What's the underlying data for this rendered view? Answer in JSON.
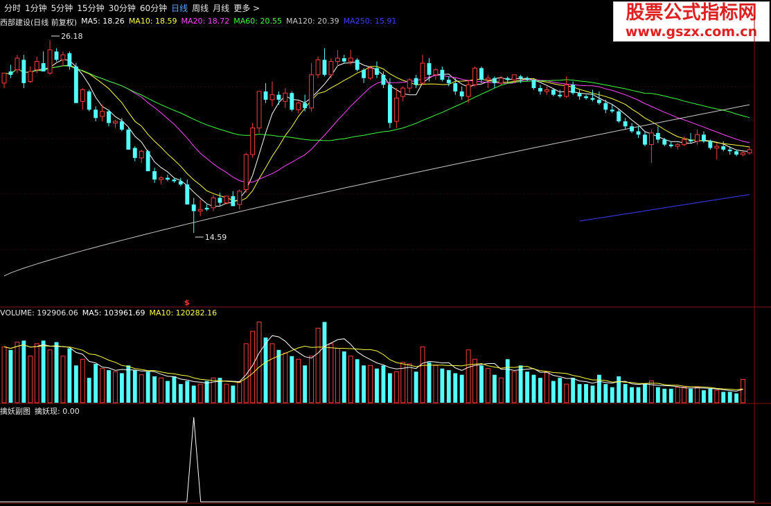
{
  "toolbar": {
    "items": [
      {
        "label": "分时",
        "active": false
      },
      {
        "label": "1分钟",
        "active": false
      },
      {
        "label": "5分钟",
        "active": false
      },
      {
        "label": "15分钟",
        "active": false
      },
      {
        "label": "30分钟",
        "active": false
      },
      {
        "label": "60分钟",
        "active": false
      },
      {
        "label": "日线",
        "active": true
      },
      {
        "label": "周线",
        "active": false
      },
      {
        "label": "月线",
        "active": false
      },
      {
        "label": "更多 >",
        "active": false
      }
    ]
  },
  "watermark": {
    "title": "股票公式指标网",
    "url": "www.gszx.com.cn"
  },
  "price_legend": {
    "name": "西部建设(日线 前复权)",
    "ma5": "MA5: 18.26",
    "ma10": "MA10: 18.59",
    "ma20": "MA20: 18.72",
    "ma60": "MA60: 20.55",
    "ma120": "MA120: 20.39",
    "ma250": "MA250: 15.91"
  },
  "volume_legend": {
    "volume": "VOLUME: 192906.06",
    "ma5": "MA5: 103961.69",
    "ma10": "MA10: 120282.16"
  },
  "indicator_legend": {
    "name": "擒妖副图",
    "value": "擒妖现: 0.00"
  },
  "marker": "$",
  "colors": {
    "up": "#ff3c3c",
    "down": "#54ffff",
    "ma5": "#ffffff",
    "ma10": "#ffff3c",
    "ma20": "#ff46ff",
    "ma60": "#3cff3c",
    "ma120": "#c8c8c8",
    "ma250": "#3c3cff"
  },
  "chart_data": [
    {
      "type": "candlestick",
      "title": "西部建设(日线 前复权)",
      "y_range": [
        14.0,
        27.0
      ],
      "annotations": [
        {
          "label": "26.18",
          "value": 26.18,
          "kind": "high"
        },
        {
          "label": "14.59",
          "value": 14.59,
          "kind": "low"
        }
      ],
      "candles": [
        [
          23.6,
          24.2,
          23.3,
          24.2
        ],
        [
          24.3,
          24.7,
          23.9,
          24.1
        ],
        [
          24.4,
          25.3,
          24.2,
          25.1
        ],
        [
          25.0,
          25.3,
          23.3,
          23.6
        ],
        [
          23.7,
          24.6,
          23.6,
          24.3
        ],
        [
          24.4,
          25.2,
          24.2,
          24.9
        ],
        [
          24.8,
          25.5,
          24.3,
          24.3
        ],
        [
          24.2,
          26.18,
          24.1,
          25.6
        ],
        [
          25.5,
          25.7,
          24.9,
          25.0
        ],
        [
          25.0,
          25.5,
          24.6,
          25.3
        ],
        [
          25.4,
          25.5,
          24.4,
          24.6
        ],
        [
          24.6,
          24.8,
          22.4,
          22.4
        ],
        [
          22.5,
          23.3,
          22.0,
          23.2
        ],
        [
          23.1,
          23.2,
          21.9,
          22.0
        ],
        [
          22.0,
          22.2,
          21.3,
          21.5
        ],
        [
          21.6,
          22.3,
          21.3,
          21.9
        ],
        [
          21.9,
          22.0,
          21.0,
          21.2
        ],
        [
          21.2,
          21.4,
          20.9,
          21.3
        ],
        [
          21.3,
          21.5,
          20.7,
          20.8
        ],
        [
          20.8,
          20.9,
          19.6,
          19.6
        ],
        [
          19.7,
          19.8,
          18.9,
          19.1
        ],
        [
          19.1,
          19.6,
          18.8,
          19.5
        ],
        [
          19.5,
          19.6,
          18.3,
          18.3
        ],
        [
          18.3,
          18.5,
          17.6,
          17.8
        ],
        [
          17.8,
          18.0,
          17.5,
          17.9
        ],
        [
          17.9,
          18.1,
          17.7,
          17.8
        ],
        [
          17.8,
          17.9,
          17.6,
          17.7
        ],
        [
          17.7,
          17.9,
          17.4,
          17.5
        ],
        [
          17.5,
          17.8,
          16.3,
          16.3
        ],
        [
          16.3,
          16.7,
          14.59,
          15.9
        ],
        [
          15.9,
          16.6,
          15.6,
          16.0
        ],
        [
          16.1,
          16.3,
          15.9,
          16.0
        ],
        [
          16.1,
          16.9,
          15.9,
          16.7
        ],
        [
          16.7,
          17.0,
          16.2,
          16.4
        ],
        [
          16.4,
          16.8,
          16.3,
          16.8
        ],
        [
          16.8,
          17.1,
          16.2,
          16.2
        ],
        [
          16.3,
          17.2,
          16.0,
          17.1
        ],
        [
          17.2,
          19.4,
          17.0,
          19.3
        ],
        [
          19.3,
          21.2,
          19.1,
          20.9
        ],
        [
          20.9,
          23.1,
          20.6,
          23.1
        ],
        [
          23.1,
          23.6,
          22.4,
          22.6
        ],
        [
          22.6,
          23.7,
          22.2,
          22.9
        ],
        [
          22.9,
          23.1,
          22.3,
          22.6
        ],
        [
          22.5,
          23.3,
          22.1,
          23.0
        ],
        [
          23.0,
          23.1,
          21.9,
          22.0
        ],
        [
          22.0,
          22.5,
          21.8,
          22.4
        ],
        [
          22.4,
          22.9,
          21.9,
          22.1
        ],
        [
          22.1,
          24.8,
          21.9,
          24.1
        ],
        [
          24.1,
          25.2,
          23.9,
          25.0
        ],
        [
          25.0,
          25.7,
          24.0,
          24.1
        ],
        [
          24.1,
          25.1,
          23.9,
          24.9
        ],
        [
          24.9,
          25.6,
          24.6,
          25.1
        ],
        [
          25.1,
          25.3,
          24.8,
          24.9
        ],
        [
          24.9,
          25.6,
          24.7,
          25.1
        ],
        [
          25.0,
          25.1,
          24.3,
          24.4
        ],
        [
          24.4,
          24.5,
          23.6,
          23.9
        ],
        [
          23.9,
          24.6,
          23.8,
          24.5
        ],
        [
          24.5,
          24.9,
          23.9,
          24.1
        ],
        [
          24.1,
          24.3,
          23.3,
          23.5
        ],
        [
          23.5,
          23.9,
          20.9,
          21.2
        ],
        [
          21.3,
          23.3,
          20.9,
          22.7
        ],
        [
          22.8,
          23.4,
          22.5,
          23.3
        ],
        [
          23.3,
          23.9,
          23.0,
          23.8
        ],
        [
          23.9,
          24.1,
          23.3,
          23.5
        ],
        [
          23.6,
          25.3,
          23.5,
          24.8
        ],
        [
          24.8,
          25.1,
          23.7,
          24.1
        ],
        [
          24.1,
          24.5,
          23.8,
          24.4
        ],
        [
          24.4,
          24.6,
          23.7,
          23.8
        ],
        [
          23.8,
          24.0,
          23.4,
          23.6
        ],
        [
          23.6,
          23.9,
          22.9,
          23.1
        ],
        [
          23.1,
          23.4,
          22.6,
          22.8
        ],
        [
          22.8,
          23.8,
          22.4,
          23.5
        ],
        [
          23.5,
          24.6,
          23.4,
          24.5
        ],
        [
          24.5,
          24.6,
          23.6,
          23.8
        ],
        [
          23.8,
          24.1,
          23.3,
          23.9
        ],
        [
          23.9,
          24.0,
          23.3,
          23.6
        ],
        [
          23.6,
          24.0,
          23.5,
          23.9
        ],
        [
          23.9,
          24.0,
          23.6,
          23.8
        ],
        [
          23.8,
          24.1,
          23.6,
          24.1
        ],
        [
          24.0,
          24.1,
          23.6,
          23.9
        ],
        [
          23.9,
          24.0,
          23.7,
          23.8
        ],
        [
          23.8,
          23.9,
          23.2,
          23.3
        ],
        [
          23.3,
          23.5,
          22.9,
          23.1
        ],
        [
          23.1,
          23.4,
          22.9,
          23.2
        ],
        [
          23.2,
          23.3,
          22.8,
          22.9
        ],
        [
          22.9,
          23.2,
          22.7,
          22.8
        ],
        [
          22.8,
          24.0,
          22.7,
          23.5
        ],
        [
          23.5,
          23.7,
          22.9,
          23.0
        ],
        [
          23.0,
          23.2,
          22.6,
          22.8
        ],
        [
          22.8,
          22.9,
          22.6,
          22.7
        ],
        [
          22.7,
          23.2,
          22.5,
          22.6
        ],
        [
          22.6,
          23.1,
          22.3,
          22.4
        ],
        [
          22.4,
          22.6,
          21.8,
          22.0
        ],
        [
          22.0,
          22.3,
          21.8,
          21.9
        ],
        [
          21.9,
          22.0,
          21.2,
          21.3
        ],
        [
          21.3,
          21.5,
          20.8,
          21.0
        ],
        [
          21.0,
          21.2,
          20.6,
          20.7
        ],
        [
          20.7,
          21.0,
          20.3,
          20.5
        ],
        [
          20.5,
          20.7,
          19.8,
          19.9
        ],
        [
          19.9,
          20.8,
          18.8,
          20.6
        ],
        [
          20.6,
          21.0,
          20.0,
          20.2
        ],
        [
          20.2,
          20.3,
          19.8,
          19.9
        ],
        [
          19.9,
          20.1,
          19.7,
          19.8
        ],
        [
          19.8,
          20.0,
          19.6,
          19.9
        ],
        [
          19.9,
          20.4,
          19.8,
          20.2
        ],
        [
          20.2,
          20.6,
          20.0,
          20.1
        ],
        [
          20.1,
          20.8,
          19.9,
          20.5
        ],
        [
          20.5,
          20.7,
          20.0,
          20.1
        ],
        [
          20.1,
          20.2,
          19.6,
          19.7
        ],
        [
          19.7,
          20.0,
          19.0,
          19.8
        ],
        [
          19.8,
          20.1,
          19.5,
          19.6
        ],
        [
          19.6,
          19.8,
          19.3,
          19.5
        ],
        [
          19.5,
          19.6,
          19.2,
          19.3
        ],
        [
          19.3,
          19.5,
          19.2,
          19.4
        ],
        [
          19.4,
          19.8,
          19.3,
          19.6
        ]
      ]
    },
    {
      "type": "bar",
      "title": "VOLUME",
      "y_range": [
        0,
        270000
      ],
      "values": [
        180000,
        170000,
        195000,
        200000,
        150000,
        190000,
        200000,
        170000,
        195000,
        150000,
        175000,
        120000,
        140000,
        80000,
        125000,
        110000,
        105000,
        100000,
        95000,
        120000,
        105000,
        90000,
        100000,
        85000,
        80000,
        70000,
        85000,
        60000,
        70000,
        55000,
        60000,
        70000,
        80000,
        80000,
        60000,
        55000,
        65000,
        190000,
        230000,
        260000,
        210000,
        190000,
        170000,
        160000,
        150000,
        140000,
        120000,
        150000,
        240000,
        260000,
        190000,
        175000,
        165000,
        150000,
        140000,
        120000,
        120000,
        110000,
        120000,
        95000,
        100000,
        130000,
        125000,
        100000,
        180000,
        130000,
        120000,
        110000,
        105000,
        95000,
        90000,
        170000,
        140000,
        120000,
        110000,
        90000,
        80000,
        140000,
        100000,
        120000,
        100000,
        90000,
        80000,
        100000,
        70000,
        80000,
        60000,
        80000,
        60000,
        60000,
        55000,
        90000,
        60000,
        50000,
        85000,
        60000,
        50000,
        50000,
        60000,
        70000,
        50000,
        45000,
        45000,
        50000,
        50000,
        45000,
        50000,
        40000,
        45000,
        40000,
        35000,
        35000,
        30000,
        75000
      ]
    },
    {
      "type": "line",
      "title": "擒妖副图",
      "y_range": [
        0,
        1
      ],
      "peak_index": 29
    }
  ]
}
